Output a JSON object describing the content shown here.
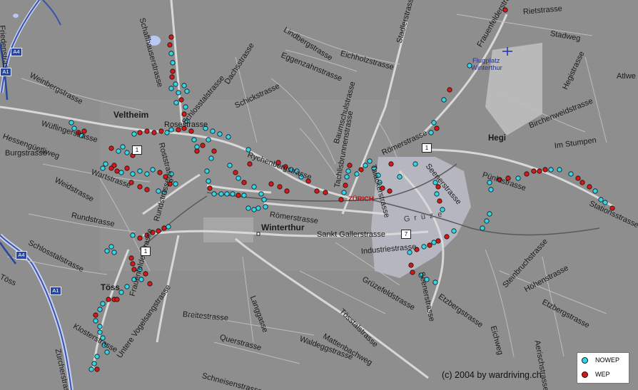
{
  "map": {
    "places": [
      {
        "id": "veltheim",
        "text": "Veltheim"
      },
      {
        "id": "winterthur",
        "text": "Winterthur"
      },
      {
        "id": "hegi",
        "text": "Hegi"
      },
      {
        "id": "toss",
        "text": "Töss"
      },
      {
        "id": "flugplatz1",
        "text": "Flugplatz"
      },
      {
        "id": "flugplatz2",
        "text": "Winterthur"
      },
      {
        "id": "zurich",
        "text": "ZÜRICH"
      },
      {
        "id": "grueze",
        "text": "Grüze"
      }
    ],
    "streets": [
      "Rietstrasse",
      "Frauenfelderstrasse",
      "Stadweg",
      "Hegistrasse",
      "Atlwe",
      "Lindbergstrasse",
      "Eichholzstrasse",
      "Stadlerstrasse",
      "Eggenzahnstrasse",
      "Dachsstrasse",
      "Schickstrasse",
      "Schlosstalstrasse",
      "Wüflingerstrasse",
      "Hessengüetliweg",
      "Burgstrasse",
      "Weinbergstrasse",
      "Weidstrasse",
      "Wartstrasse",
      "Rundstrasse",
      "Schlosstalstrasse",
      "Rychenbergstrasse",
      "Römerstrasse",
      "Römerstrasse",
      "Baumschulstrasse",
      "Tachlisbrunnenstrasse",
      "Talackerstrasse",
      "Seenerstrasse",
      "Birchenweidstrasse",
      "Im Stumpen",
      "Pünktstrasse",
      "Stationsstrasse",
      "Sankt Gallerstrasse",
      "Industriestrasse",
      "Grüzefeldstrasse",
      "Seenerstrasse",
      "Etzbergstrasse",
      "Eichweg",
      "Steinbruchstrasse",
      "Höhenstrasse",
      "Etzbergstrasse",
      "Aerischstrasse",
      "Rosestrasse",
      "Zürcherstrasse",
      "Untere Vogelsangstrasse",
      "Breitestrasse",
      "Langgasse",
      "Tösstalstrasse",
      "Querstrasse",
      "Mattenbachweg",
      "Waldeggstrasse",
      "Schneisenstrasse",
      "Klosterstrasse",
      "Schaffhauserstrasse",
      "Töss",
      "Frauenfelderstrasse",
      "Roststrasse",
      "Rundstrasse",
      "Friedenstrasse"
    ],
    "route_shields": [
      "1",
      "1",
      "7",
      "1",
      "A4",
      "A1",
      "A4",
      "A1"
    ],
    "legend": {
      "items": [
        {
          "label": "NOWEP",
          "color": "#33d6e8"
        },
        {
          "label": "WEP",
          "color": "#d81818"
        }
      ]
    },
    "copyright": "(c) 2004 by wardriving.ch"
  }
}
